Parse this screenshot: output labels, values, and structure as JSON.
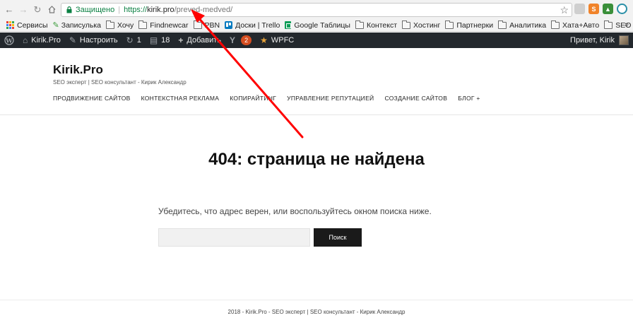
{
  "browser": {
    "back_icon": "arrow-left-icon",
    "forward_icon": "arrow-right-icon",
    "home_icon": "home-icon",
    "secure_label": "Защищено",
    "url_scheme": "https://",
    "url_host": "kirik.pro",
    "url_path": "/preved-medved/",
    "star_icon": "star-icon"
  },
  "bookmarks": {
    "items": [
      {
        "label": "Сервисы",
        "icon": "apps-icon"
      },
      {
        "label": "Записулька",
        "icon": "pencil-icon"
      },
      {
        "label": "Хочу",
        "icon": "folder-icon"
      },
      {
        "label": "Findnewcar",
        "icon": "folder-icon"
      },
      {
        "label": "PBN",
        "icon": "folder-icon"
      },
      {
        "label": "Доски | Trello",
        "icon": "trello-icon"
      },
      {
        "label": "Google Таблицы",
        "icon": "sheets-icon"
      },
      {
        "label": "Контекст",
        "icon": "folder-icon"
      },
      {
        "label": "Хостинг",
        "icon": "folder-icon"
      },
      {
        "label": "Партнерки",
        "icon": "folder-icon"
      },
      {
        "label": "Аналитика",
        "icon": "folder-icon"
      },
      {
        "label": "Хата+Авто",
        "icon": "folder-icon"
      },
      {
        "label": "SEO",
        "icon": "folder-icon"
      }
    ],
    "overflow": "»"
  },
  "admin_bar": {
    "site_name": "Kirik.Pro",
    "customize": "Настроить",
    "updates_count": "1",
    "comments_count": "18",
    "add_new": "Добавить",
    "yoast_badge": "2",
    "wpfc": "WPFC",
    "greeting": "Привет, Kirik"
  },
  "site": {
    "title": "Kirik.Pro",
    "description": "SEO эксперт | SEO консультант - Кирик Александр",
    "nav": [
      "ПРОДВИЖЕНИЕ САЙТОВ",
      "КОНТЕКСТНАЯ РЕКЛАМА",
      "КОПИРАЙТИНГ",
      "УПРАВЛЕНИЕ РЕПУТАЦИЕЙ",
      "СОЗДАНИЕ САЙТОВ",
      "БЛОГ +"
    ]
  },
  "error": {
    "title": "404: страница не найдена",
    "message": "Убедитесь, что адрес верен, или воспользуйтесь окном поиска ниже.",
    "search_value": "",
    "search_button": "Поиск"
  },
  "footer": {
    "text": "2018 - Kirik.Pro - SEO эксперт | SEO консультант - Кирик Александр"
  },
  "colors": {
    "admin_bar": "#23282d",
    "secure_green": "#0b8043",
    "arrow_red": "#ff0000",
    "search_button": "#1a1a1a"
  }
}
